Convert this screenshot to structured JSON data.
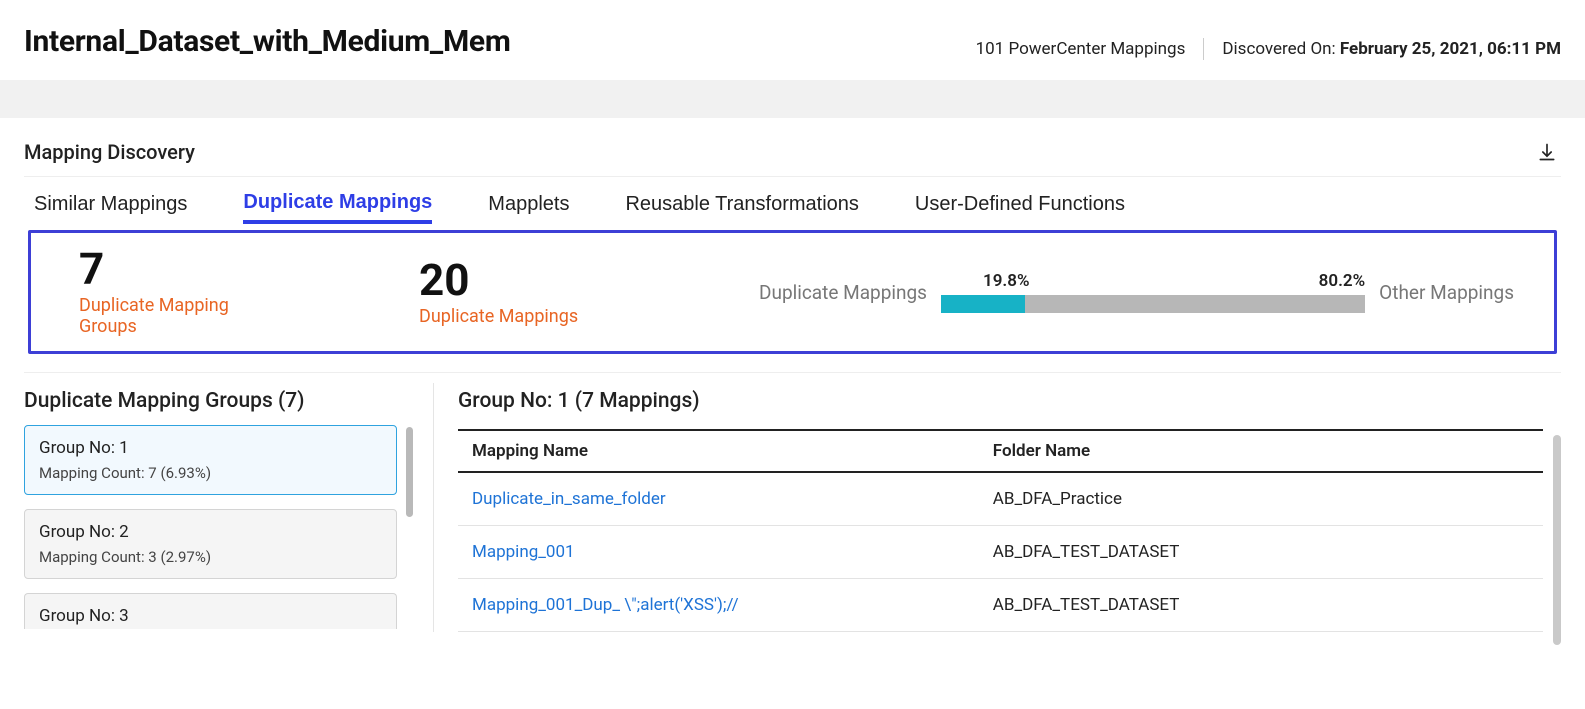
{
  "header": {
    "title": "Internal_Dataset_with_Medium_Mem",
    "mappings_count_text": "101 PowerCenter Mappings",
    "discovered_label": "Discovered On: ",
    "discovered_value": "February 25, 2021, 06:11 PM"
  },
  "section": {
    "title": "Mapping Discovery"
  },
  "tabs": [
    {
      "label": "Similar Mappings",
      "active": false
    },
    {
      "label": "Duplicate Mappings",
      "active": true
    },
    {
      "label": "Mapplets",
      "active": false
    },
    {
      "label": "Reusable Transformations",
      "active": false
    },
    {
      "label": "User-Defined Functions",
      "active": false
    }
  ],
  "summary": {
    "stat1_value": "7",
    "stat1_label": "Duplicate Mapping Groups",
    "stat2_value": "20",
    "stat2_label": "Duplicate Mappings",
    "chart_left_label": "Duplicate Mappings",
    "chart_right_label": "Other Mappings",
    "pct1": "19.8%",
    "pct2": "80.2%"
  },
  "chart_data": {
    "type": "bar",
    "categories": [
      "Duplicate Mappings",
      "Other Mappings"
    ],
    "values": [
      19.8,
      80.2
    ],
    "title": "",
    "xlabel": "",
    "ylabel": "",
    "ylim": [
      0,
      100
    ]
  },
  "left": {
    "title": "Duplicate Mapping Groups (7)",
    "groups": [
      {
        "name": "Group No: 1",
        "sub": "Mapping Count: 7 (6.93%)",
        "active": true
      },
      {
        "name": "Group No: 2",
        "sub": "Mapping Count: 3 (2.97%)",
        "active": false
      },
      {
        "name": "Group No: 3",
        "sub": "",
        "active": false,
        "peek": true
      }
    ]
  },
  "right": {
    "title": "Group No: 1 (7 Mappings)",
    "columns": {
      "c1": "Mapping Name",
      "c2": "Folder Name"
    },
    "rows": [
      {
        "name": "Duplicate_in_same_folder",
        "folder": "AB_DFA_Practice"
      },
      {
        "name": "Mapping_001",
        "folder": "AB_DFA_TEST_DATASET"
      },
      {
        "name": "Mapping_001_Dup_ \\\";alert('XSS');//",
        "folder": "AB_DFA_TEST_DATASET"
      }
    ]
  }
}
